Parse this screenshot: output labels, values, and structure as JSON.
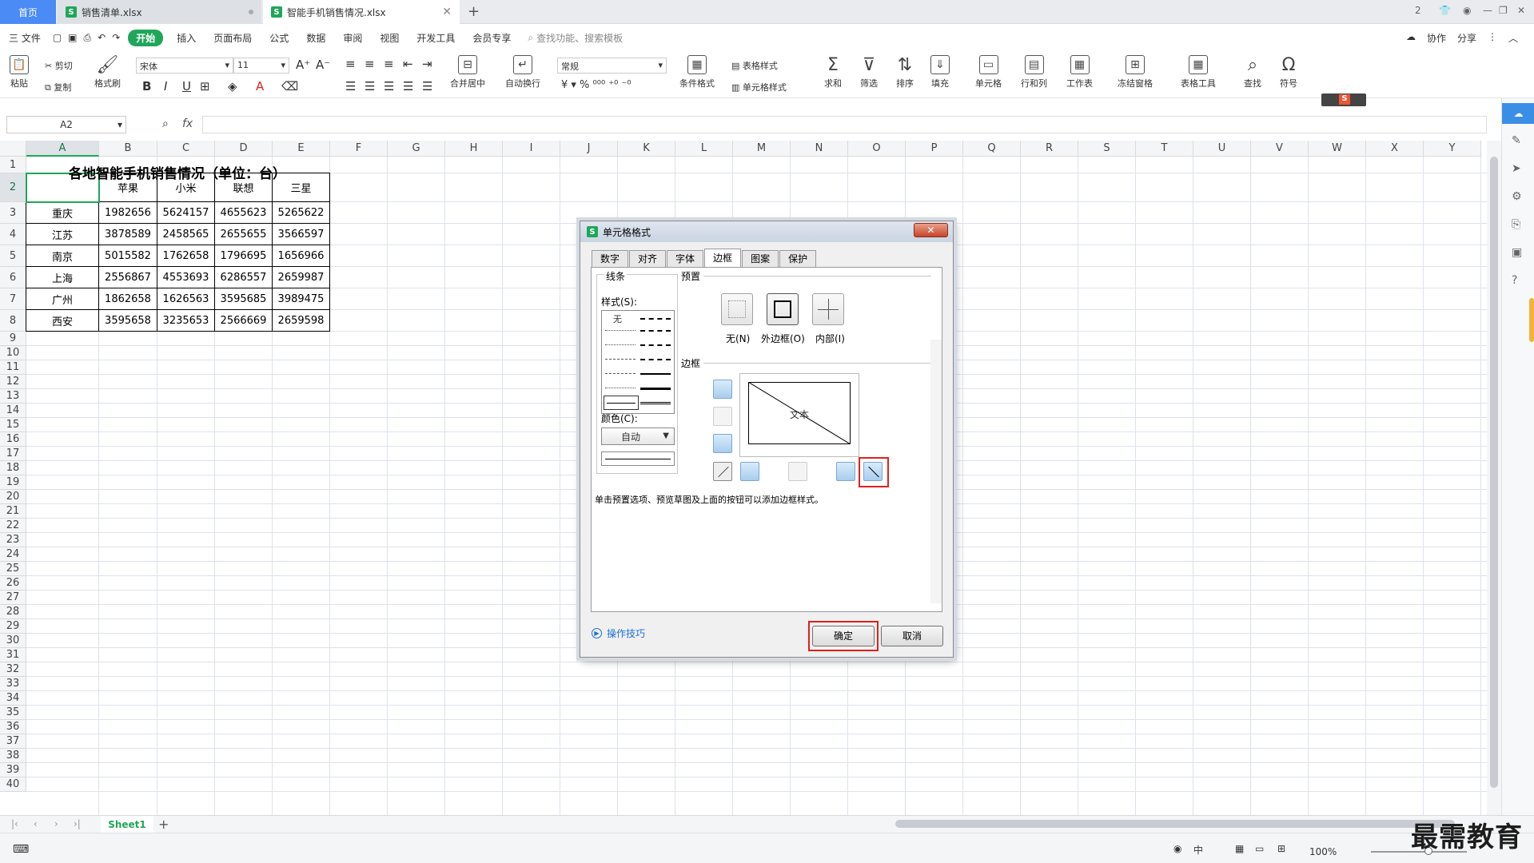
{
  "tabs": {
    "home": "首页",
    "file1": "销售清单.xlsx",
    "file2": "智能手机销售情况.xlsx"
  },
  "menu": {
    "file": "三 文件",
    "items": [
      "开始",
      "插入",
      "页面布局",
      "公式",
      "数据",
      "审阅",
      "视图",
      "开发工具",
      "会员专享"
    ],
    "search": "查找功能、搜索模板",
    "collab": "协作",
    "share": "分享"
  },
  "ribbon": {
    "paste": "粘贴",
    "cut": "剪切",
    "copy": "复制",
    "format_painter": "格式刷",
    "font_name": "宋体",
    "font_size": "11",
    "merge_center": "合并居中",
    "wrap": "自动换行",
    "number_format": "常规",
    "cond_format": "条件格式",
    "table_style": "表格样式",
    "cell_style": "单元格样式",
    "sum": "求和",
    "filter": "筛选",
    "sort": "排序",
    "fill": "填充",
    "cell": "单元格",
    "row_col": "行和列",
    "sheet": "工作表",
    "freeze": "冻结窗格",
    "table_tools": "表格工具",
    "find": "查找",
    "symbol": "符号"
  },
  "formula_bar": {
    "name_box": "A2",
    "fx": "fx"
  },
  "grid": {
    "columns": [
      "A",
      "B",
      "C",
      "D",
      "E",
      "F",
      "G",
      "H",
      "I",
      "J",
      "K",
      "L",
      "M",
      "N",
      "O",
      "P",
      "Q",
      "R",
      "S",
      "T",
      "U",
      "V",
      "W",
      "X",
      "Y"
    ],
    "rows": [
      "1",
      "2",
      "3",
      "4",
      "5",
      "6",
      "7",
      "8",
      "9",
      "10",
      "11",
      "12",
      "13",
      "14",
      "15",
      "16",
      "17",
      "18",
      "19",
      "20",
      "21",
      "22",
      "23",
      "24",
      "25",
      "26",
      "27",
      "28",
      "29",
      "30",
      "31",
      "32",
      "33",
      "34",
      "35",
      "36",
      "37",
      "38",
      "39",
      "40"
    ],
    "title": "各地智能手机销售情况（单位：台）",
    "headers": [
      "",
      "苹果",
      "小米",
      "联想",
      "三星"
    ],
    "data": [
      [
        "重庆",
        "1982656",
        "5624157",
        "4655623",
        "5265622"
      ],
      [
        "江苏",
        "3878589",
        "2458565",
        "2655655",
        "3566597"
      ],
      [
        "南京",
        "5015582",
        "1762658",
        "1796695",
        "1656966"
      ],
      [
        "上海",
        "2556867",
        "4553693",
        "6286557",
        "2659987"
      ],
      [
        "广州",
        "1862658",
        "1626563",
        "3595685",
        "3989475"
      ],
      [
        "西安",
        "3595658",
        "3235653",
        "2566669",
        "2659598"
      ]
    ]
  },
  "sheet": {
    "name": "Sheet1",
    "add": "+"
  },
  "status": {
    "zoom": "100%"
  },
  "watermark": "最需教育",
  "dialog": {
    "title": "单元格格式",
    "tabs": [
      "数字",
      "对齐",
      "字体",
      "边框",
      "图案",
      "保护"
    ],
    "line_group": "线条",
    "style_label": "样式(S):",
    "style_none": "无",
    "color_label": "颜色(C):",
    "color_value": "自动",
    "preset_group": "预置",
    "preset_none": "无(N)",
    "preset_outline": "外边框(O)",
    "preset_inside": "内部(I)",
    "border_group": "边框",
    "preview_text": "文本",
    "hint": "单击预置选项、预览草图及上面的按钮可以添加边框样式。",
    "tips": "操作技巧",
    "ok": "确定",
    "cancel": "取消"
  }
}
